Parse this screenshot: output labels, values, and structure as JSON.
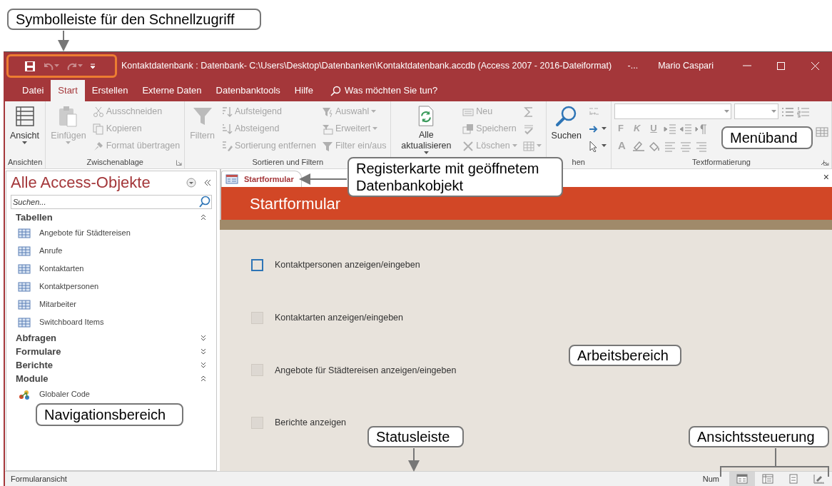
{
  "callouts": [
    {
      "text": "Symbolleiste für den Schnellzugriff",
      "kind": "highlight-arrow"
    },
    {
      "text": "Menüband",
      "kind": "plain"
    },
    {
      "text": "Registerkarte mit geöffnetem Datenbankobjekt",
      "kind": "arrow-left"
    },
    {
      "text": "Arbeitsbereich",
      "kind": "plain"
    },
    {
      "text": "Navigationsbereich",
      "kind": "plain"
    },
    {
      "text": "Statusleiste",
      "kind": "arrow-down"
    },
    {
      "text": "Ansichtssteuerung",
      "kind": "bracket"
    }
  ],
  "quick_access": [
    {
      "kind": "save",
      "disabled": false
    },
    {
      "kind": "undo",
      "disabled": true
    },
    {
      "kind": "redo",
      "disabled": true
    },
    {
      "kind": "customize",
      "disabled": false
    }
  ],
  "window": {
    "title": "Kontaktdatenbank : Datenbank- C:\\Users\\Desktop\\Datenbanken\\Kontaktdatenbank.accdb (Access 2007 - 2016-Dateiformat)",
    "title_more": "-...",
    "user": "Mario Caspari"
  },
  "ribbon_tabs": [
    {
      "label": "Datei",
      "selected": false
    },
    {
      "label": "Start",
      "selected": true
    },
    {
      "label": "Erstellen",
      "selected": false
    },
    {
      "label": "Externe Daten",
      "selected": false
    },
    {
      "label": "Datenbanktools",
      "selected": false
    },
    {
      "label": "Hilfe",
      "selected": false
    }
  ],
  "tell_me": "Was möchten Sie tun?",
  "ribbon_groups": [
    {
      "label": "Ansichten",
      "columns": [
        [
          {
            "label": "Ansicht",
            "kind": "view",
            "disabled": false,
            "dropdown": true
          }
        ]
      ]
    },
    {
      "label": "Zwischenablage",
      "launcher": true,
      "columns": [
        [
          {
            "label": "Einfügen",
            "kind": "paste",
            "disabled": true,
            "dropdown": true
          }
        ],
        [
          {
            "label": "Ausschneiden",
            "kind": "cut",
            "disabled": true
          },
          {
            "label": "Kopieren",
            "kind": "copy",
            "disabled": true
          },
          {
            "label": "Format übertragen",
            "kind": "painter",
            "disabled": true
          }
        ]
      ]
    },
    {
      "label": "Sortieren und Filtern",
      "columns": [
        [
          {
            "label": "Filtern",
            "kind": "filter",
            "disabled": true
          }
        ],
        [
          {
            "label": "Aufsteigend",
            "kind": "sort-asc",
            "disabled": true
          },
          {
            "label": "Absteigend",
            "kind": "sort-desc",
            "disabled": true
          },
          {
            "label": "Sortierung entfernen",
            "kind": "sort-clear",
            "disabled": true
          }
        ],
        [
          {
            "label": "Auswahl",
            "kind": "selection",
            "disabled": true,
            "dropdown": true
          },
          {
            "label": "Erweitert",
            "kind": "advanced",
            "disabled": true,
            "dropdown": true
          },
          {
            "label": "Filter ein/aus",
            "kind": "toggle",
            "disabled": true
          }
        ]
      ]
    },
    {
      "columns": [
        [
          {
            "label": "Alle aktualisieren",
            "kind": "refresh",
            "disabled": false,
            "dropdown": true
          }
        ],
        [
          {
            "label": "Neu",
            "kind": "new",
            "disabled": true
          },
          {
            "label": "Speichern",
            "kind": "save",
            "disabled": true
          },
          {
            "label": "Löschen",
            "kind": "delete",
            "disabled": true,
            "dropdown": true
          }
        ],
        [
          {
            "kind": "totals",
            "disabled": true
          },
          {
            "kind": "spelling",
            "disabled": true
          },
          {
            "kind": "more",
            "disabled": true,
            "dropdown": true
          }
        ]
      ]
    },
    {
      "label": "hen",
      "columns": [
        [
          {
            "label": "Suchen",
            "kind": "find",
            "disabled": false
          }
        ],
        [
          {
            "kind": "replace",
            "disabled": true
          },
          {
            "kind": "goto",
            "disabled": false,
            "dropdown": true
          },
          {
            "kind": "select",
            "disabled": false,
            "dropdown": true
          }
        ]
      ]
    },
    {
      "label": "Textformatierung",
      "launcher": true,
      "kind": "text-format",
      "style_buttons": [
        {
          "label": "F",
          "disabled": true
        },
        {
          "label": "K",
          "disabled": true
        },
        {
          "label": "U",
          "disabled": true
        }
      ],
      "color_button": {
        "label": "A",
        "disabled": true
      }
    }
  ],
  "nav": {
    "title": "Alle Access-Objekte",
    "search_placeholder": "Suchen...",
    "groups": [
      {
        "label": "Tabellen",
        "expanded": true,
        "children": [
          {
            "label": "Angebote für Städtereisen",
            "kind": "table"
          },
          {
            "label": "Anrufe",
            "kind": "table"
          },
          {
            "label": "Kontaktarten",
            "kind": "table"
          },
          {
            "label": "Kontaktpersonen",
            "kind": "table"
          },
          {
            "label": "Mitarbeiter",
            "kind": "table"
          },
          {
            "label": "Switchboard Items",
            "kind": "table"
          }
        ]
      },
      {
        "label": "Abfragen",
        "expanded": false
      },
      {
        "label": "Formulare",
        "expanded": false
      },
      {
        "label": "Berichte",
        "expanded": false
      },
      {
        "label": "Module",
        "expanded": true,
        "children": [
          {
            "label": "Globaler Code",
            "kind": "module"
          }
        ]
      }
    ]
  },
  "document_tabs": [
    {
      "label": "Startformular",
      "selected": true
    }
  ],
  "document_close": "×",
  "form": {
    "title": "Startformular",
    "buttons": [
      {
        "label": "Kontaktpersonen anzeigen/eingeben",
        "focused": true
      },
      {
        "label": "Kontaktarten anzeigen/eingeben",
        "focused": false
      },
      {
        "label": "Angebote für Städtereisen anzeigen/eingeben",
        "focused": false
      },
      {
        "label": "Berichte anzeigen",
        "focused": false
      }
    ]
  },
  "status_bar": {
    "text": "Formularansicht",
    "num": "Num",
    "views": [
      {
        "kind": "form",
        "selected": true
      },
      {
        "kind": "datasheet",
        "selected": false
      },
      {
        "kind": "layout",
        "selected": false
      },
      {
        "kind": "design",
        "selected": false
      }
    ]
  }
}
